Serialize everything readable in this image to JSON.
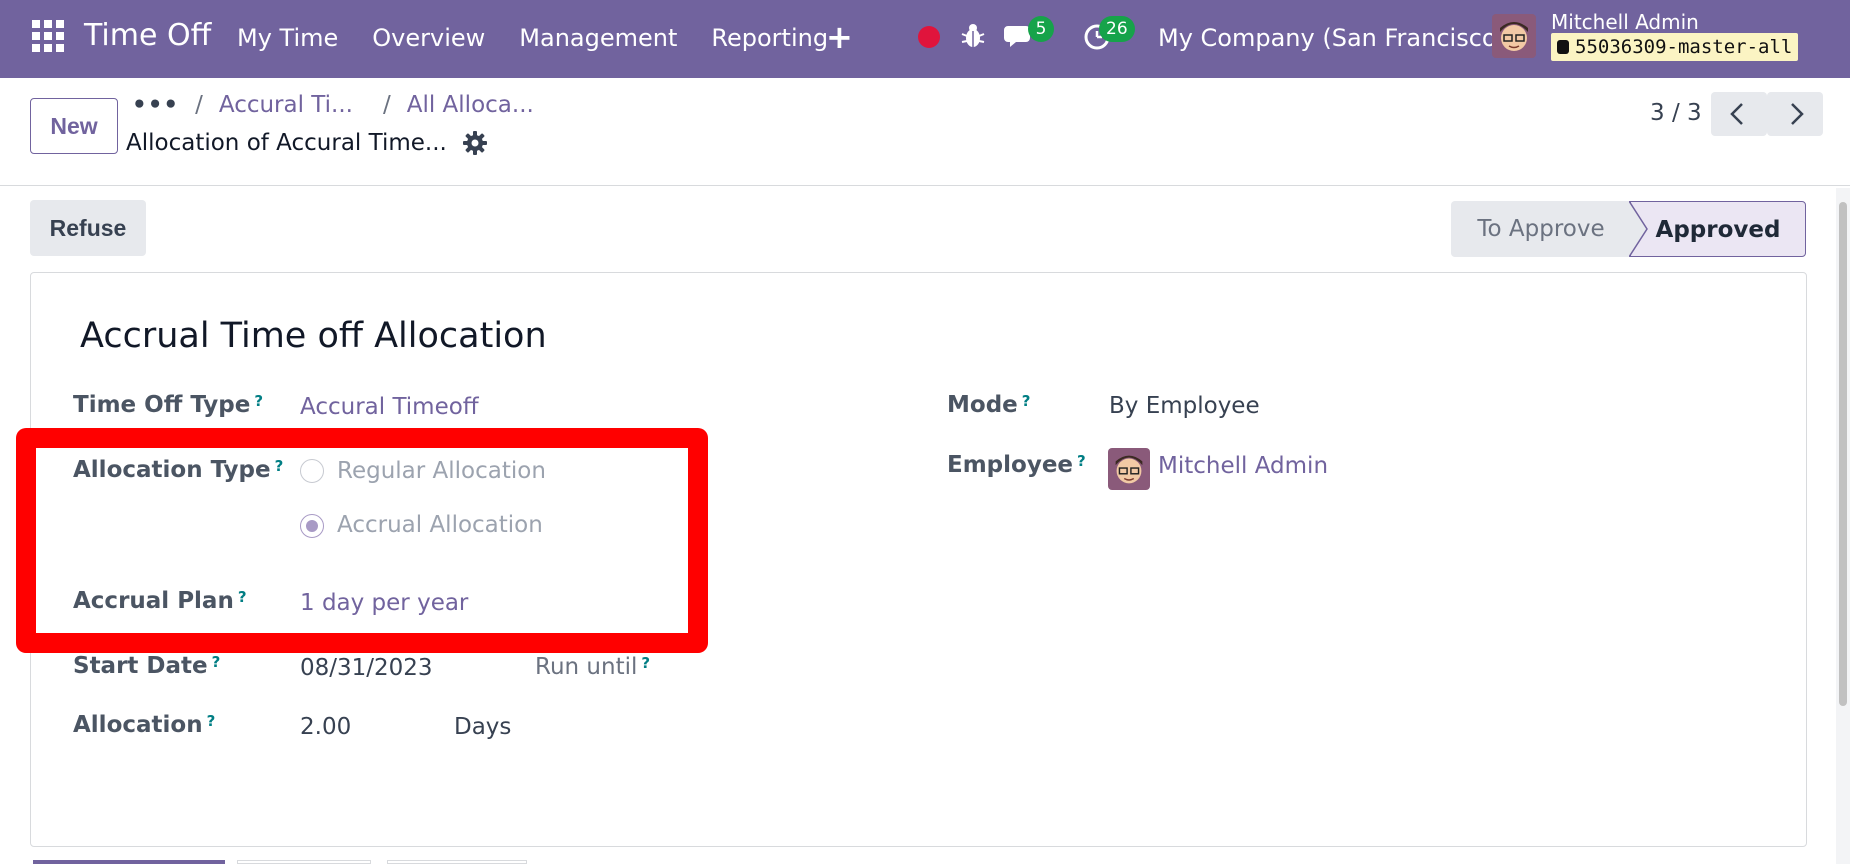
{
  "navbar": {
    "app_title": "Time Off",
    "menu": [
      "My Time",
      "Overview",
      "Management",
      "Reporting"
    ],
    "messages_count": "5",
    "activities_count": "26",
    "company": "My Company (San Francisco)",
    "user_name": "Mitchell Admin",
    "database": "55036309-master-all"
  },
  "control": {
    "new_label": "New",
    "breadcrumbs": [
      "Accural Ti...",
      "All Alloca..."
    ],
    "record_title": "Allocation of Accural Time...",
    "pager": "3 / 3"
  },
  "status": {
    "refuse_label": "Refuse",
    "stages": [
      "To Approve",
      "Approved"
    ],
    "current_stage": "Approved"
  },
  "form": {
    "title": "Accrual Time off Allocation",
    "time_off_type_label": "Time Off Type",
    "time_off_type_value": "Accural Timeoff",
    "allocation_type_label": "Allocation Type",
    "allocation_type_options": [
      "Regular Allocation",
      "Accrual Allocation"
    ],
    "allocation_type_selected": "Accrual Allocation",
    "accrual_plan_label": "Accrual Plan",
    "accrual_plan_value": "1 day per year",
    "start_date_label": "Start Date",
    "start_date_value": "08/31/2023",
    "run_until_label": "Run until",
    "allocation_label": "Allocation",
    "allocation_value": "2.00",
    "allocation_unit": "Days",
    "mode_label": "Mode",
    "mode_value": "By Employee",
    "employee_label": "Employee",
    "employee_value": "Mitchell Admin",
    "help_mark": "?"
  },
  "colors": {
    "brand": "#71639e",
    "highlight": "#ff0000",
    "badge": "#16a34a"
  }
}
